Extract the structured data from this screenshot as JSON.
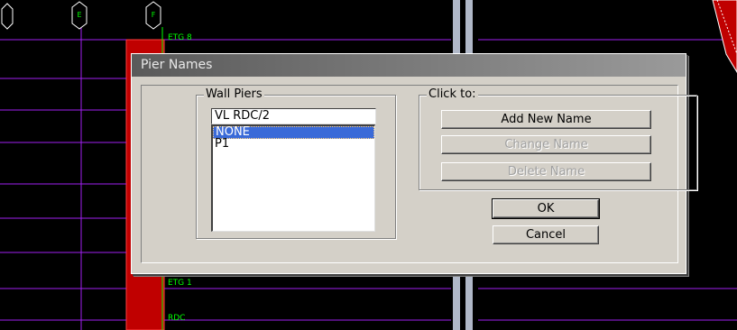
{
  "background": {
    "grid_labels": {
      "story_top": "ETG 8",
      "story_mid": "ETG 1",
      "story_base": "RDC"
    },
    "bubbles": [
      "E",
      "F"
    ]
  },
  "dialog": {
    "title": "Pier Names",
    "wall_piers": {
      "legend": "Wall Piers",
      "name_value": "VL RDC/2",
      "items": [
        "NONE",
        "P1"
      ],
      "selected_index": 0
    },
    "click_to": {
      "legend": "Click to:",
      "add_label": "Add New Name",
      "change_label": "Change Name",
      "delete_label": "Delete Name"
    },
    "ok_label": "OK",
    "cancel_label": "Cancel"
  },
  "colors": {
    "grid_lines": "#a020f0",
    "labels": "#00ff00",
    "wall_fill": "#c00000",
    "column": "#b0b8c8",
    "selection": "#3a6ad8"
  }
}
